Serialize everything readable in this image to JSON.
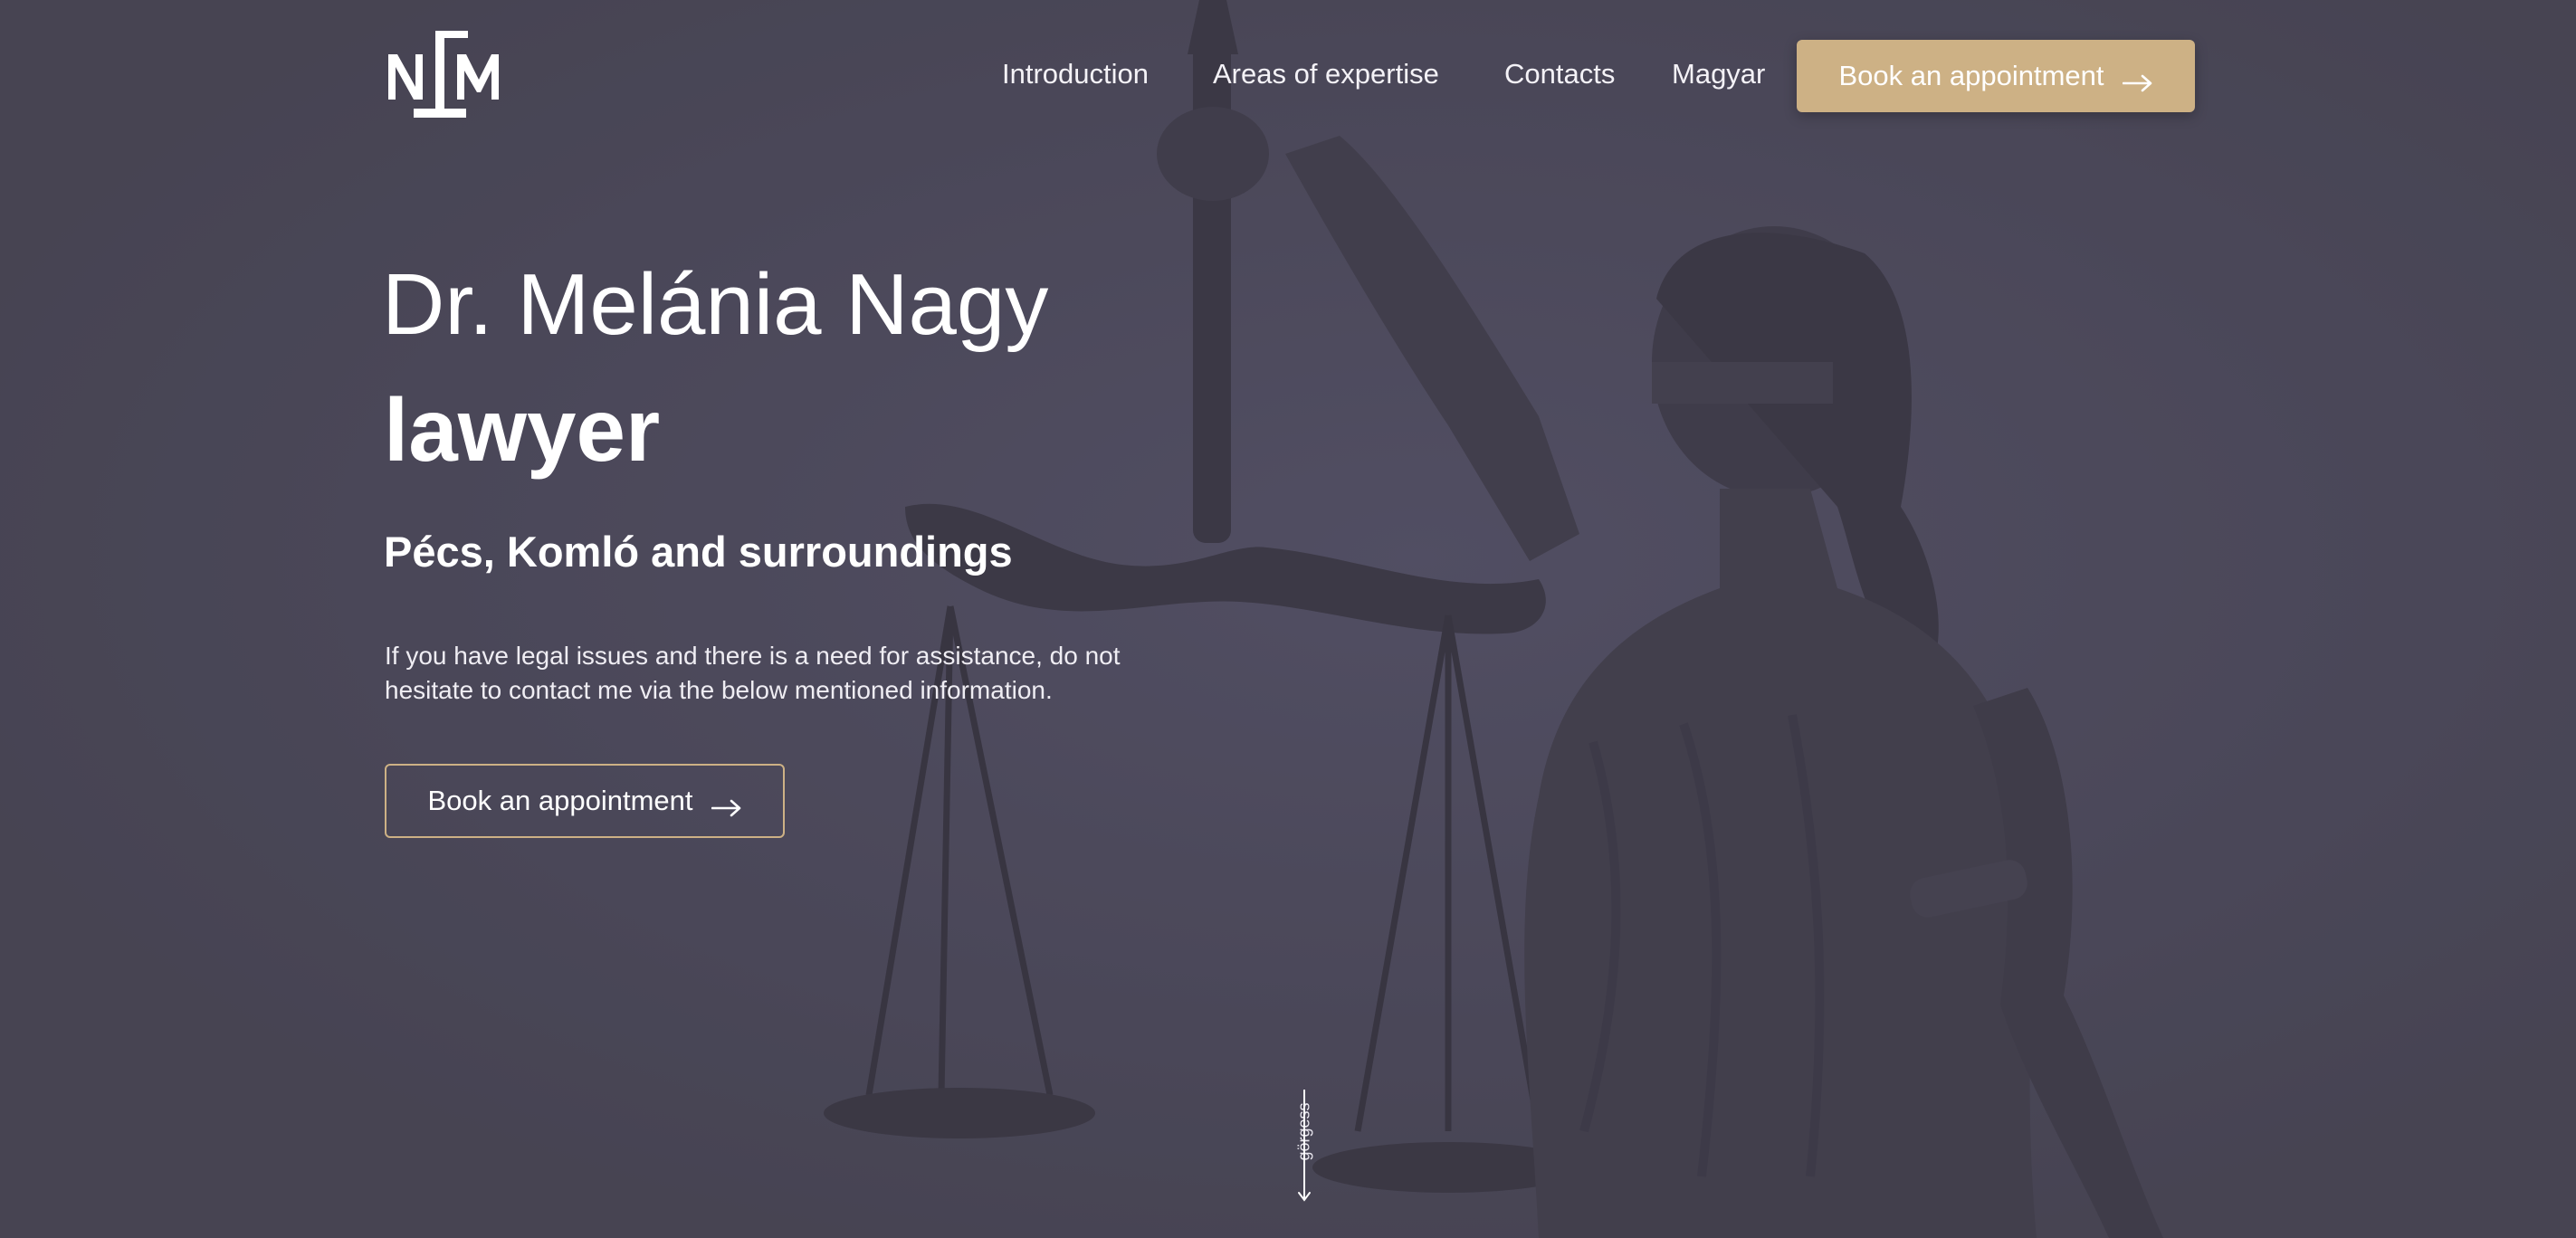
{
  "colors": {
    "overlay": "#4a4756",
    "accent": "#cdb185",
    "text": "#ffffff"
  },
  "header": {
    "logo_icon": "nlm-monogram-logo",
    "nav": {
      "introduction": "Introduction",
      "areas": "Areas of expertise",
      "contacts": "Contacts",
      "language": "Magyar"
    },
    "cta_label": "Book an appointment",
    "cta_icon": "arrow-right-icon"
  },
  "hero": {
    "title": "Dr. Melánia Nagy",
    "role": "lawyer",
    "location": "Pécs, Komló and surroundings",
    "description": "If you have legal issues and there is a need for assistance, do not hesitate to contact me via the below mentioned information.",
    "cta_label": "Book an appointment",
    "cta_icon": "arrow-right-icon",
    "background_icon": "lady-justice-statue"
  },
  "scroll": {
    "label": "görgess",
    "icon": "arrow-down-icon"
  }
}
